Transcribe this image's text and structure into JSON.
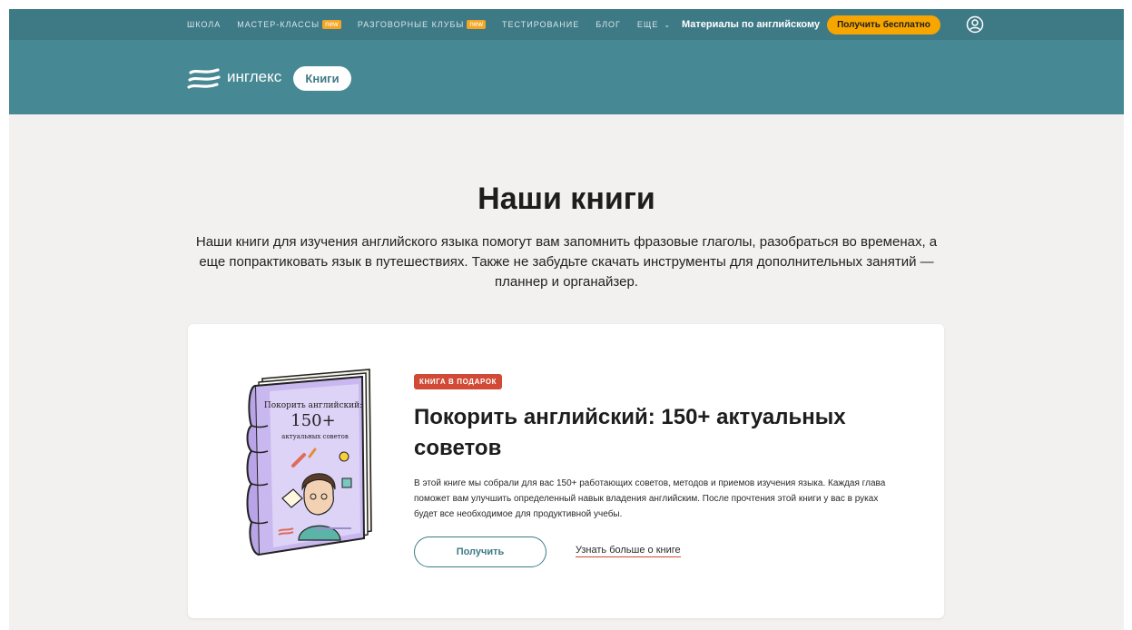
{
  "nav": {
    "items": [
      {
        "label": "ШКОЛА",
        "badge": ""
      },
      {
        "label": "МАСТЕР-КЛАССЫ",
        "badge": "new"
      },
      {
        "label": "РАЗГОВОРНЫЕ КЛУБЫ",
        "badge": "new"
      },
      {
        "label": "ТЕСТИРОВАНИЕ",
        "badge": ""
      },
      {
        "label": "БЛОГ",
        "badge": ""
      },
      {
        "label": "ЕЩЕ",
        "badge": ""
      }
    ],
    "materials_label": "Материалы по английскому",
    "cta_label": "Получить бесплатно"
  },
  "brand": {
    "logo_text": "инглекс",
    "section_label": "Книги"
  },
  "hero": {
    "title": "Наши книги",
    "subtitle": "Наши книги для изучения английского языка помогут вам запомнить фразовые глаголы, разобраться во временах, а еще попрактиковать язык в путешествиях. Также не забудьте скачать инструменты для дополнительных занятий — планнер и органайзер."
  },
  "card": {
    "badge": "КНИГА В ПОДАРОК",
    "title": "Покорить английский: 150+ актуальных советов",
    "description": "В этой книге мы собрали для вас 150+ работающих советов, методов и приемов изучения языка. Каждая глава поможет вам улучшить определенный навык владения английским. После прочтения этой книги у вас в руках будет все необходимое для продуктивной учебы.",
    "get_button": "Получить",
    "more_link": "Узнать больше о книге",
    "cover": {
      "line1": "Покорить английский:",
      "line2": "150+",
      "line3": "актуальных советов"
    }
  },
  "colors": {
    "topbar": "#3e7a86",
    "brandbar": "#468893",
    "accent_yellow": "#f7a600",
    "badge_red": "#d04a35",
    "page_bg": "#f2f1ef"
  },
  "icons": {
    "user": "user-circle-icon",
    "chevron": "chevron-down-icon",
    "logo": "inglex-logo-icon"
  }
}
